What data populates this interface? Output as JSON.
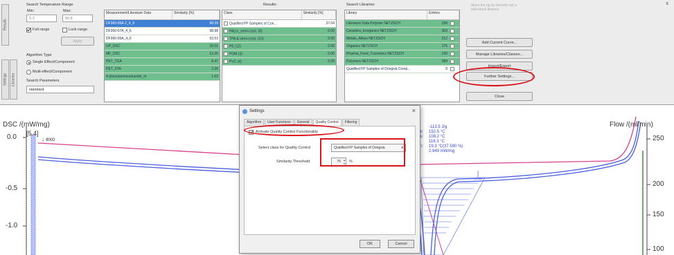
{
  "window": {
    "close_glyph": "x"
  },
  "vtabs": [
    "Results",
    "Settings",
    "Libraries"
  ],
  "temp_range": {
    "title": "Search Temperature Range",
    "min_label": "Min:",
    "max_label": "Max:",
    "min_value": "5.3",
    "max_value": "90.8",
    "full_range_label": "Full range",
    "lock_range_label": "Lock range",
    "apply_label": "Apply"
  },
  "algorithm": {
    "title": "Algorithm Type",
    "options": [
      "Single Effect/Component",
      "Multi-effect/Component"
    ],
    "selected_index": 0,
    "params_title": "Search Parameters",
    "params_value": "standard"
  },
  "measurement_table": {
    "headers": [
      "Measurement/Literature Data",
      "Similarity [%]"
    ],
    "rows": [
      {
        "name": "DF360-05A-2_4_6",
        "sim": "98.39"
      },
      {
        "name": "DF360-07A_4_6",
        "sim": "98.98"
      },
      {
        "name": "DF360-05A_4_6",
        "sim": "53.53"
      },
      {
        "name": "UP_DSC",
        "sim": "15.01"
      },
      {
        "name": "MF_DSC",
        "sim": "13.26"
      },
      {
        "name": "PET_TGA",
        "sim": "8.47"
      },
      {
        "name": "PET_STA",
        "sim": "3.36"
      },
      {
        "name": "4-phenylsemicarbazide_In",
        "sim": "1.62"
      }
    ]
  },
  "results": {
    "title": "Results:",
    "headers": [
      "Class",
      "Similarity [%]"
    ],
    "rows": [
      {
        "name": "Qualified FP Samples of Con...",
        "sim": "37.04"
      },
      {
        "name": "PA(co_semi-cryst. (8)",
        "sim": "0.00"
      },
      {
        "name": "TPA & semi-cryst. (10)",
        "sim": "0.00"
      },
      {
        "name": "PE (12)",
        "sim": "0.00"
      },
      {
        "name": "POM (3)",
        "sim": "0.00"
      },
      {
        "name": "PVC (4)",
        "sim": "0.00"
      }
    ]
  },
  "libraries": {
    "title": "Search Libraries:",
    "headers": [
      "Library",
      "Entries"
    ],
    "rows": [
      {
        "name": "Literature Data Polymer NETZSCH",
        "entries": "298"
      },
      {
        "name": "Ceramics_Inorganics NETZSCH",
        "entries": "303"
      },
      {
        "name": "Metals_Alloys NETZSCH",
        "entries": "212"
      },
      {
        "name": "Organics NETZSCH",
        "entries": "175"
      },
      {
        "name": "Pharma_Food_Cosmetics NETZSCH",
        "entries": "230"
      },
      {
        "name": "Polymers NETZSCH",
        "entries": "389"
      },
      {
        "name": "Qualified FP Samples of Dongxia Comp...",
        "entries": "8"
      }
    ],
    "hint": "Move the up its Security not a selection/Libraries"
  },
  "actions": {
    "add_curve": "Add Current Curve...",
    "manage": "Manage Libraries/Classes...",
    "import_export": "Import/Export",
    "further": "Further Settings...",
    "close": "Close"
  },
  "chart": {
    "y_left_label": "DSC /(mW/mg)",
    "y_right_label": "Flow /(ml/min)",
    "step_label": "[5.4]",
    "exo_label": "↓ exo",
    "left_ticks": [
      "0.0",
      "-0.5",
      "-1.0"
    ],
    "right_ticks": [
      "250",
      "200",
      "150",
      "100"
    ],
    "annotations": [
      {
        "key": "",
        "val": "-113.5 J/g"
      },
      {
        "key": "ak:",
        "val": "152.5 °C"
      },
      {
        "key": "ak:",
        "val": "108.2 °C"
      },
      {
        "key": "",
        "val": "118.3 °C"
      },
      {
        "key": "ith:",
        "val": "19.3 °C(37.590 %)"
      },
      {
        "key": "",
        "val": "2.949 mW/mg"
      }
    ],
    "colors": {
      "dsc": "#4a5fe0",
      "flow": "#d8408f",
      "marker": "#7d8bf0",
      "green": "#3f8f3f"
    }
  },
  "dialog": {
    "title": "Settings",
    "close_glyph": "×",
    "tabs": [
      "Algorithm",
      "User Functions",
      "General",
      "Quality Control",
      "Filtering"
    ],
    "active_tab": 3,
    "activate_label": "Activate Quality Control Functionality",
    "select_label": "Select class for Quality Control",
    "select_value": "Qualified FP Samples of Dongxia",
    "threshold_label": "Similarity Threshold",
    "threshold_value": "75",
    "threshold_unit": "%",
    "ok": "OK",
    "cancel": "Cancel"
  }
}
